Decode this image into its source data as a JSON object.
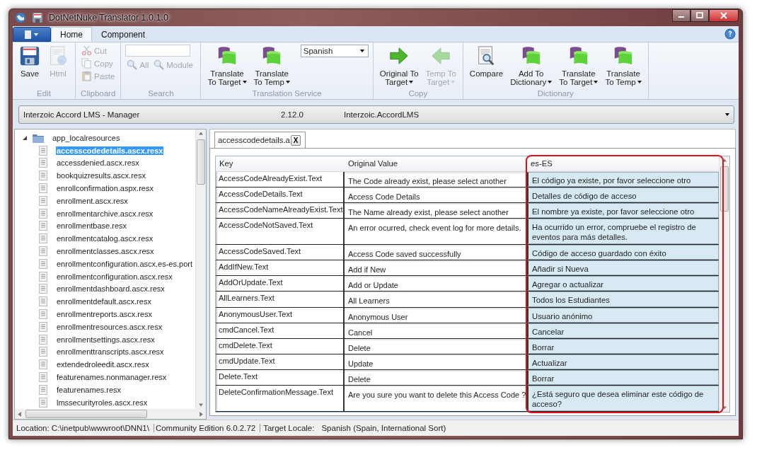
{
  "window": {
    "title": "DotNetNuke Translator 1.0.1.0"
  },
  "ribbon": {
    "tabs": [
      {
        "label": "Home",
        "selected": true
      },
      {
        "label": "Component",
        "selected": false
      }
    ],
    "groups": [
      {
        "label": "Edit",
        "kind": "buttons",
        "items": [
          {
            "kind": "large",
            "lines": [
              "Save"
            ],
            "disabled": false,
            "dropdown": false
          },
          {
            "kind": "large",
            "lines": [
              "Html"
            ],
            "disabled": true,
            "dropdown": false
          }
        ]
      },
      {
        "label": "Clipboard",
        "kind": "stack",
        "items": [
          {
            "kind": "small",
            "lines": [
              "Cut"
            ],
            "disabled": true
          },
          {
            "kind": "small",
            "lines": [
              "Copy"
            ],
            "disabled": true
          },
          {
            "kind": "small",
            "lines": [
              "Paste"
            ],
            "disabled": true
          }
        ]
      },
      {
        "label": "Search",
        "kind": "search",
        "items": [
          {
            "kind": "field"
          },
          {
            "kind": "small",
            "lines": [
              "All"
            ],
            "disabled": true
          },
          {
            "kind": "small",
            "lines": [
              "Module"
            ],
            "disabled": true
          }
        ]
      },
      {
        "label": "Translation Service",
        "kind": "buttons",
        "items": [
          {
            "kind": "large",
            "lines": [
              "Translate",
              "To Target"
            ],
            "disabled": false,
            "dropdown": true
          },
          {
            "kind": "large",
            "lines": [
              "Translate",
              "To Temp"
            ],
            "disabled": false,
            "dropdown": true
          },
          {
            "kind": "select",
            "value": "Spanish"
          }
        ]
      },
      {
        "label": "Copy",
        "kind": "buttons",
        "items": [
          {
            "kind": "large",
            "lines": [
              "Original To",
              "Target"
            ],
            "disabled": false,
            "dropdown": true
          },
          {
            "kind": "large",
            "lines": [
              "Temp To",
              "Target"
            ],
            "disabled": true,
            "dropdown": true
          }
        ]
      },
      {
        "label": "Dictionary",
        "kind": "buttons",
        "items": [
          {
            "kind": "large",
            "lines": [
              "Compare"
            ],
            "disabled": false,
            "dropdown": false
          },
          {
            "kind": "large",
            "lines": [
              "Add To",
              "Dictionary"
            ],
            "disabled": false,
            "dropdown": true
          },
          {
            "kind": "large",
            "lines": [
              "Translate",
              "To Target"
            ],
            "disabled": false,
            "dropdown": true
          },
          {
            "kind": "large",
            "lines": [
              "Translate",
              "To Temp"
            ],
            "disabled": false,
            "dropdown": true
          }
        ]
      }
    ]
  },
  "component_select": {
    "name": "Interzoic Accord LMS - Manager",
    "version": "2.12.0",
    "package": "Interzoic.AccordLMS"
  },
  "tree": {
    "label": "app_localresources",
    "expanded": true,
    "children": [
      {
        "label": "accesscodedetails.ascx.resx",
        "selected": true
      },
      {
        "label": "accessdenied.ascx.resx",
        "selected": false
      },
      {
        "label": "bookquizresults.ascx.resx",
        "selected": false
      },
      {
        "label": "enrollconfirmation.aspx.resx",
        "selected": false
      },
      {
        "label": "enrollment.ascx.resx",
        "selected": false
      },
      {
        "label": "enrollmentarchive.ascx.resx",
        "selected": false
      },
      {
        "label": "enrollmentbase.resx",
        "selected": false
      },
      {
        "label": "enrollmentcatalog.ascx.resx",
        "selected": false
      },
      {
        "label": "enrollmentclasses.ascx.resx",
        "selected": false
      },
      {
        "label": "enrollmentconfiguration.ascx.es-es.port",
        "selected": false
      },
      {
        "label": "enrollmentconfiguration.ascx.resx",
        "selected": false
      },
      {
        "label": "enrollmentdashboard.ascx.resx",
        "selected": false
      },
      {
        "label": "enrollmentdefault.ascx.resx",
        "selected": false
      },
      {
        "label": "enrollmentreports.ascx.resx",
        "selected": false
      },
      {
        "label": "enrollmentresources.ascx.resx",
        "selected": false
      },
      {
        "label": "enrollmentsettings.ascx.resx",
        "selected": false
      },
      {
        "label": "enrollmenttranscripts.ascx.resx",
        "selected": false
      },
      {
        "label": "extendedroleedit.ascx.resx",
        "selected": false
      },
      {
        "label": "featurenames.nonmanager.resx",
        "selected": false
      },
      {
        "label": "featurenames.resx",
        "selected": false
      },
      {
        "label": "lmssecurityroles.ascx.resx",
        "selected": false
      }
    ]
  },
  "document_tab": {
    "label": "accesscodedetails.a",
    "close": "X"
  },
  "table": {
    "columns": [
      "Key",
      "Original Value",
      "es-ES"
    ],
    "rows": [
      {
        "key": "AccessCodeAlreadyExist.Text",
        "original": "The Code already exist, please select another",
        "target": "El código ya existe, por favor seleccione otro"
      },
      {
        "key": "AccessCodeDetails.Text",
        "original": "Access Code Details",
        "target": "Detalles de código de acceso"
      },
      {
        "key": "AccessCodeNameAlreadyExist.Text",
        "original": "The Name already exist, please select another",
        "target": "El nombre ya existe, por favor seleccione otro"
      },
      {
        "key": "AccessCodeNotSaved.Text",
        "original": "An error ocurred, check event log for more details.",
        "target": "Ha ocurrido un error, compruebe el registro de eventos para más detalles."
      },
      {
        "key": "AccessCodeSaved.Text",
        "original": "Access Code saved successfully",
        "target": "Código de acceso guardado con éxito"
      },
      {
        "key": "AddIfNew.Text",
        "original": "Add if New",
        "target": "Añadir si Nueva"
      },
      {
        "key": "AddOrUpdate.Text",
        "original": "Add or Update",
        "target": "Agregar o actualizar"
      },
      {
        "key": "AllLearners.Text",
        "original": "All Learners",
        "target": "Todos los Estudiantes"
      },
      {
        "key": "AnonymousUser.Text",
        "original": "Anonymous User",
        "target": "Usuario anónimo"
      },
      {
        "key": "cmdCancel.Text",
        "original": "Cancel",
        "target": "Cancelar"
      },
      {
        "key": "cmdDelete.Text",
        "original": "Delete",
        "target": "Borrar"
      },
      {
        "key": "cmdUpdate.Text",
        "original": "Update",
        "target": "Actualizar"
      },
      {
        "key": "Delete.Text",
        "original": "Delete",
        "target": "Borrar"
      },
      {
        "key": "DeleteConfirmationMessage.Text",
        "original": "Are you sure you want to delete this Access Code ?",
        "target": "¿Está seguro que desea eliminar este código de acceso?"
      }
    ]
  },
  "status_bar": {
    "location": "Location: C:\\inetpub\\wwwroot\\DNN1\\",
    "edition": "Community Edition  6.0.2.72",
    "locale_label": "Target Locale:",
    "locale": "Spanish (Spain, International Sort)"
  }
}
